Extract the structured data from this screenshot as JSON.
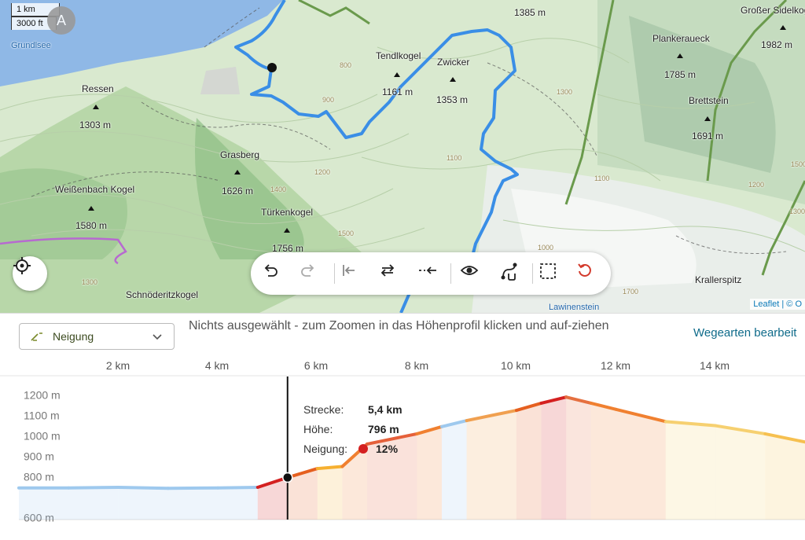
{
  "map": {
    "scale": {
      "metric": "1 km",
      "imperial": "3000 ft"
    },
    "waypoint_marker": "A",
    "lake_label": "Grundlsee",
    "peaks": [
      {
        "name": "Ressen",
        "elevation": "1303 m"
      },
      {
        "name": "Grasberg",
        "elevation": "1626 m"
      },
      {
        "name": "Weißenbach Kogel",
        "elevation": "1580 m"
      },
      {
        "name": "Türkenkogel",
        "elevation": "1756 m"
      },
      {
        "name": "Tendlkogel",
        "elevation": "1161 m"
      },
      {
        "name": "Zwicker",
        "elevation": "1353 m"
      },
      {
        "name": "Plankeraueck",
        "elevation": "1785 m"
      },
      {
        "name": "Brettstein",
        "elevation": "1691 m"
      },
      {
        "name": "Großer Sidelkogel",
        "elevation": "1982 m"
      },
      {
        "name": "",
        "elevation": "1385 m"
      },
      {
        "name": "Schnöderitzkogel",
        "elevation": ""
      },
      {
        "name": "Krallerspitz",
        "elevation": ""
      },
      {
        "name": "Lawinenstein",
        "elevation": ""
      }
    ],
    "contours": [
      "800",
      "900",
      "1100",
      "1100",
      "1200",
      "1300",
      "1400",
      "1500",
      "1200",
      "1300",
      "1700",
      "1000",
      "1300",
      "1500"
    ],
    "attribution": {
      "brand": "Leaflet",
      "rest": " | © O"
    }
  },
  "toolbar": {
    "icons": [
      "undo-icon",
      "redo-icon",
      "go-to-start-icon",
      "reverse-route-icon",
      "return-to-start-icon",
      "eye-icon",
      "waypoint-edit-icon",
      "select-area-icon",
      "reset-icon"
    ],
    "accent_color": "#d33a2c"
  },
  "profile": {
    "dropdown_label": "Neigung",
    "status_text": "Nichts ausgewählt - zum Zoomen in das Höhenprofil klicken und auf-ziehen",
    "edit_link": "Wegearten bearbeit",
    "x_ticks": [
      "2 km",
      "4 km",
      "6 km",
      "8 km",
      "10 km",
      "12 km",
      "14 km"
    ],
    "y_ticks": [
      "1200 m",
      "1100 m",
      "1000 m",
      "900 m",
      "800 m",
      "600 m"
    ],
    "tooltip": {
      "distance_label": "Strecke:",
      "distance_value": "5,4 km",
      "height_label": "Höhe:",
      "height_value": "796 m",
      "grade_label": "Neigung:",
      "grade_value": "12%",
      "grade_color": "#d42020"
    }
  },
  "chart_data": {
    "type": "area",
    "xlabel": "",
    "ylabel": "",
    "x_unit": "km",
    "y_unit": "m",
    "xlim": [
      0,
      15.8
    ],
    "ylim": [
      590,
      1260
    ],
    "series": [
      {
        "x": [
          0,
          1.0,
          2.0,
          3.0,
          4.0,
          4.8,
          5.4,
          6.0,
          6.5,
          7.0,
          8.0,
          8.5,
          9.0,
          10.0,
          10.5,
          11.0,
          11.5,
          12.0,
          13.0,
          14.0,
          15.0,
          15.8
        ],
        "y": [
          745,
          745,
          748,
          743,
          745,
          748,
          796,
          840,
          850,
          960,
          1010,
          1045,
          1075,
          1125,
          1160,
          1190,
          1160,
          1130,
          1070,
          1050,
          1010,
          970
        ],
        "grade_colors": [
          "#9ec9ee",
          "#9ec9ee",
          "#9ec9ee",
          "#9ec9ee",
          "#9ec9ee",
          "#d42020",
          "#e56020",
          "#f6b030",
          "#f08030",
          "#e5603a",
          "#f08030",
          "#9ec9ee",
          "#f0a050",
          "#e56020",
          "#d42020",
          "#e57040",
          "#f08030",
          "#f08030",
          "#f6d070",
          "#f6d070",
          "#f6c050",
          "#f6d070"
        ]
      }
    ],
    "cursor": {
      "x": 5.4,
      "y": 796
    }
  }
}
